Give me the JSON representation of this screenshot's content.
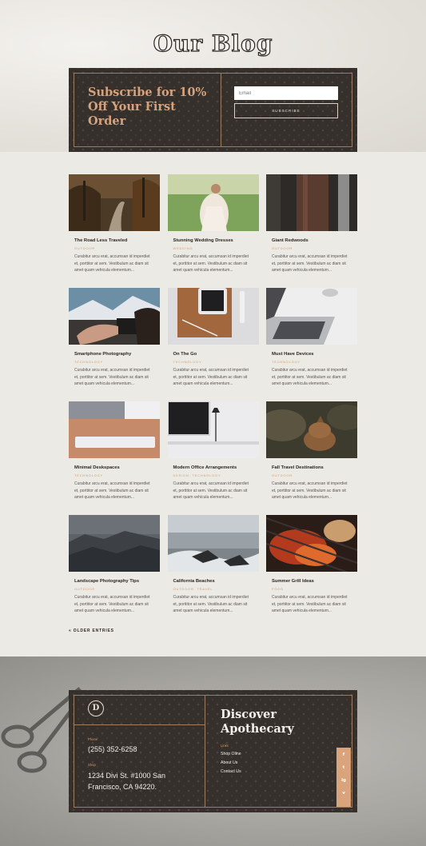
{
  "hero": {
    "title": "Our Blog",
    "subscribe_heading": "Subscribe for 10% Off Your First Order",
    "email_placeholder": "Email",
    "subscribe_button": "SUBSCRIBE"
  },
  "posts": [
    {
      "title": "The Road Less Traveled",
      "category": "OUTDOOR",
      "excerpt": "Curabitur arcu erat, accumsan id imperdiet et, porttitor at sem. Vestibulum ac diam sit amet quam vehicula elementum..."
    },
    {
      "title": "Stunning Wedding Dresses",
      "category": "WEDDING",
      "excerpt": "Curabitur arcu erat, accumsan id imperdiet et, porttitor at sem. Vestibulum ac diam sit amet quam vehicula elementum..."
    },
    {
      "title": "Giant Redwoods",
      "category": "OUTDOOR",
      "excerpt": "Curabitur arcu erat, accumsan id imperdiet et, porttitor at sem. Vestibulum ac diam sit amet quam vehicula elementum..."
    },
    {
      "title": "Smartphone Photography",
      "category": "TECHNOLOGY",
      "excerpt": "Curabitur arcu erat, accumsan id imperdiet et, porttitor at sem. Vestibulum ac diam sit amet quam vehicula elementum..."
    },
    {
      "title": "On The Go",
      "category": "TECHNOLOGY",
      "excerpt": "Curabitur arcu erat, accumsan id imperdiet et, porttitor at sem. Vestibulum ac diam sit amet quam vehicula elementum..."
    },
    {
      "title": "Must Have Devices",
      "category": "TECHNOLOGY",
      "excerpt": "Curabitur arcu erat, accumsan id imperdiet et, porttitor at sem. Vestibulum ac diam sit amet quam vehicula elementum..."
    },
    {
      "title": "Minimal Deskspaces",
      "category": "TECHNOLOGY",
      "excerpt": "Curabitur arcu erat, accumsan id imperdiet et, porttitor at sem. Vestibulum ac diam sit amet quam vehicula elementum..."
    },
    {
      "title": "Modern Office Arrangements",
      "category": "DESIGN, TECHNOLOGY",
      "excerpt": "Curabitur arcu erat, accumsan id imperdiet et, porttitor at sem. Vestibulum ac diam sit amet quam vehicula elementum..."
    },
    {
      "title": "Fall Travel Destinations",
      "category": "OUTDOOR",
      "excerpt": "Curabitur arcu erat, accumsan id imperdiet et, porttitor at sem. Vestibulum ac diam sit amet quam vehicula elementum..."
    },
    {
      "title": "Landscape Photography Tips",
      "category": "OUTDOOR",
      "excerpt": "Curabitur arcu erat, accumsan id imperdiet et, porttitor at sem. Vestibulum ac diam sit amet quam vehicula elementum..."
    },
    {
      "title": "California Beaches",
      "category": "OUTDOOR, TRAVEL",
      "excerpt": "Curabitur arcu erat, accumsan id imperdiet et, porttitor at sem. Vestibulum ac diam sit amet quam vehicula elementum..."
    },
    {
      "title": "Summer Grill Ideas",
      "category": "FOOD",
      "excerpt": "Curabitur arcu erat, accumsan id imperdiet et, porttitor at sem. Vestibulum ac diam sit amet quam vehicula elementum..."
    }
  ],
  "pagination": {
    "older_entries": "« OLDER ENTRIES"
  },
  "footer": {
    "logo_letter": "D",
    "phone_label": "Phone",
    "phone": "(255) 352-6258",
    "shop_label": "Shop",
    "address": "1234 Divi St. #1000 San Francisco, CA 94220.",
    "heading": "Discover Apothecary",
    "links_label": "Links",
    "links": [
      "Shop Oline",
      "About Us",
      "Contact Us"
    ],
    "social": [
      "f",
      "t",
      "ig",
      "v"
    ]
  },
  "colors": {
    "accent": "#d49a6a",
    "panel": "#35302c",
    "border": "#9b7d62"
  }
}
